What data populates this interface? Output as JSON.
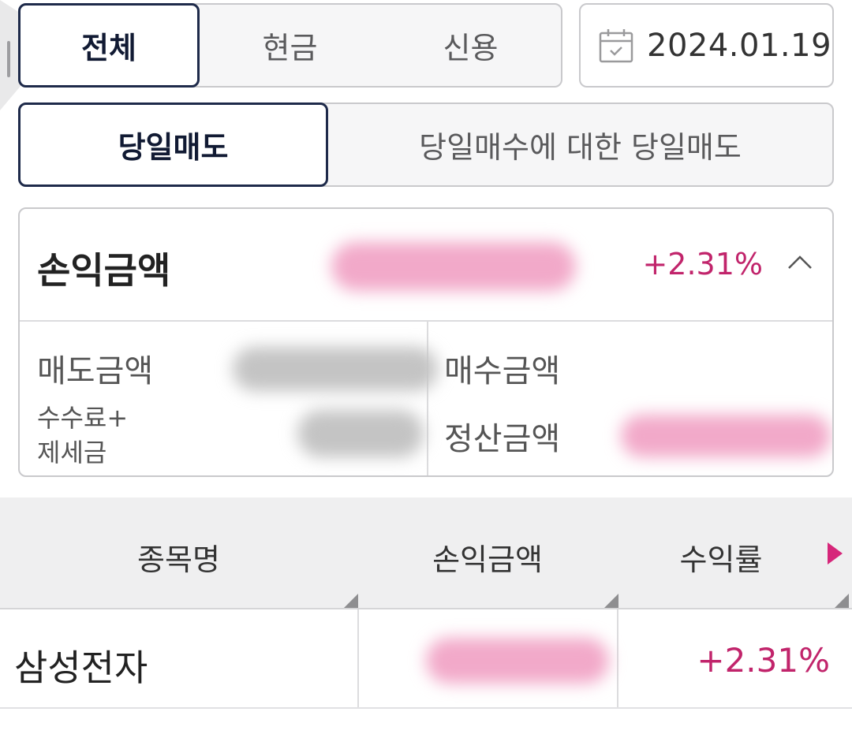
{
  "tabs_type": {
    "items": [
      {
        "label": "전체",
        "active": true
      },
      {
        "label": "현금",
        "active": false
      },
      {
        "label": "신용",
        "active": false
      }
    ]
  },
  "date_picker": {
    "value": "2024.01.19",
    "icon": "calendar-icon"
  },
  "tabs_trade": {
    "items": [
      {
        "label": "당일매도",
        "active": true
      },
      {
        "label": "당일매수에 대한 당일매도",
        "active": false
      }
    ]
  },
  "summary": {
    "title": "손익금액",
    "rate": "+2.31%",
    "toggle_icon": "chevron-up-icon",
    "sell_amount_label": "매도금액",
    "buy_amount_label": "매수금액",
    "fee_tax_label_line1": "수수료+",
    "fee_tax_label_line2": "제세금",
    "settlement_label": "정산금액"
  },
  "table": {
    "headers": {
      "name": "종목명",
      "pnl": "손익금액",
      "rate": "수익률"
    },
    "rows": [
      {
        "name": "삼성전자",
        "rate": "+2.31%"
      }
    ]
  },
  "colors": {
    "accent_positive": "#c1246b",
    "active_border": "#1e2a4a",
    "scroll_arrow": "#d6267a"
  }
}
